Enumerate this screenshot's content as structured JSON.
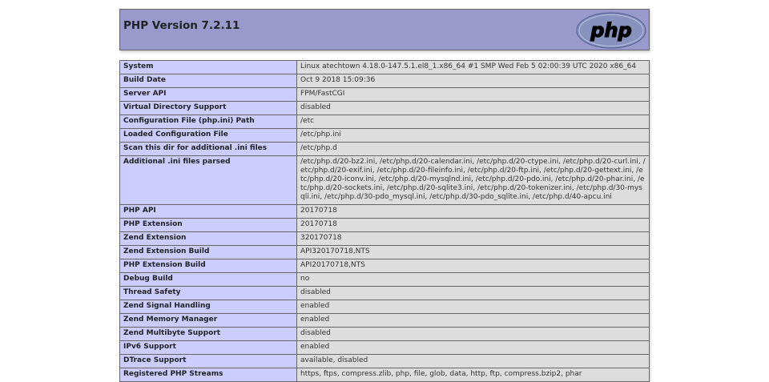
{
  "header": {
    "title": "PHP Version 7.2.11",
    "logo_text": "php"
  },
  "rows": [
    {
      "key": "System",
      "value": "Linux atechtown 4.18.0-147.5.1.el8_1.x86_64 #1 SMP Wed Feb 5 02:00:39 UTC 2020 x86_64"
    },
    {
      "key": "Build Date",
      "value": "Oct 9 2018 15:09:36"
    },
    {
      "key": "Server API",
      "value": "FPM/FastCGI"
    },
    {
      "key": "Virtual Directory Support",
      "value": "disabled"
    },
    {
      "key": "Configuration File (php.ini) Path",
      "value": "/etc"
    },
    {
      "key": "Loaded Configuration File",
      "value": "/etc/php.ini"
    },
    {
      "key": "Scan this dir for additional .ini files",
      "value": "/etc/php.d"
    },
    {
      "key": "Additional .ini files parsed",
      "value": "/etc/php.d/20-bz2.ini, /etc/php.d/20-calendar.ini, /etc/php.d/20-ctype.ini, /etc/php.d/20-curl.ini, /etc/php.d/20-exif.ini, /etc/php.d/20-fileinfo.ini, /etc/php.d/20-ftp.ini, /etc/php.d/20-gettext.ini, /etc/php.d/20-iconv.ini, /etc/php.d/20-mysqlnd.ini, /etc/php.d/20-pdo.ini, /etc/php.d/20-phar.ini, /etc/php.d/20-sockets.ini, /etc/php.d/20-sqlite3.ini, /etc/php.d/20-tokenizer.ini, /etc/php.d/30-mysqli.ini, /etc/php.d/30-pdo_mysql.ini, /etc/php.d/30-pdo_sqlite.ini, /etc/php.d/40-apcu.ini"
    },
    {
      "key": "PHP API",
      "value": "20170718"
    },
    {
      "key": "PHP Extension",
      "value": "20170718"
    },
    {
      "key": "Zend Extension",
      "value": "320170718"
    },
    {
      "key": "Zend Extension Build",
      "value": "API320170718,NTS"
    },
    {
      "key": "PHP Extension Build",
      "value": "API20170718,NTS"
    },
    {
      "key": "Debug Build",
      "value": "no"
    },
    {
      "key": "Thread Safety",
      "value": "disabled"
    },
    {
      "key": "Zend Signal Handling",
      "value": "enabled"
    },
    {
      "key": "Zend Memory Manager",
      "value": "enabled"
    },
    {
      "key": "Zend Multibyte Support",
      "value": "disabled"
    },
    {
      "key": "IPv6 Support",
      "value": "enabled"
    },
    {
      "key": "DTrace Support",
      "value": "available, disabled"
    },
    {
      "key": "Registered PHP Streams",
      "value": "https, ftps, compress.zlib, php, file, glob, data, http, ftp, compress.bzip2, phar"
    }
  ]
}
